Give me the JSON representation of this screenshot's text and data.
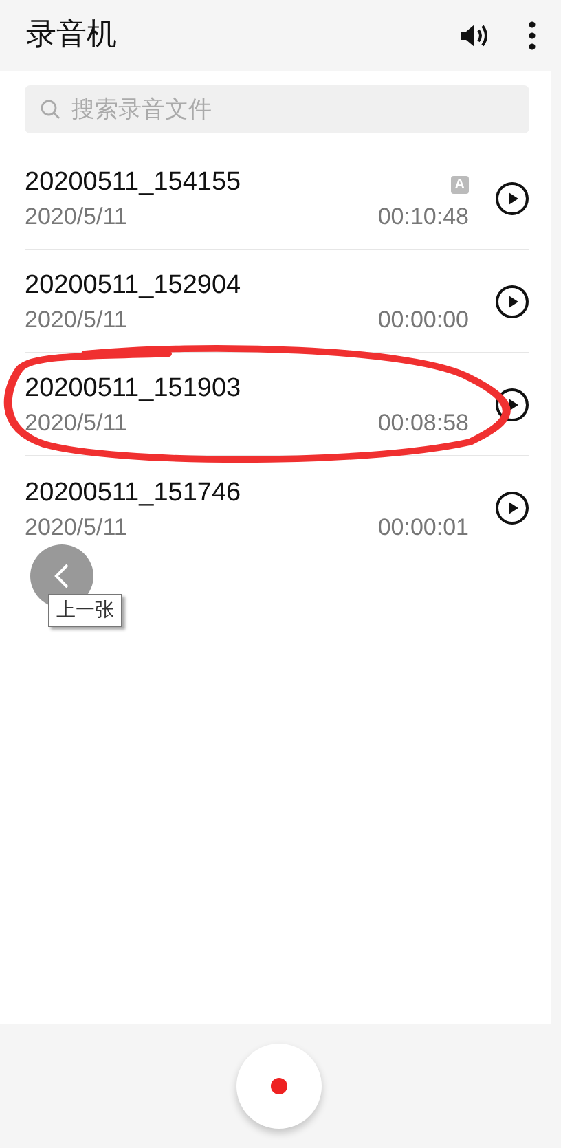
{
  "app_bar": {
    "title": "录音机"
  },
  "search": {
    "placeholder": "搜索录音文件"
  },
  "recordings": [
    {
      "name": "20200511_154155",
      "date": "2020/5/11",
      "duration": "00:10:48",
      "badge": "A",
      "circled": false
    },
    {
      "name": "20200511_152904",
      "date": "2020/5/11",
      "duration": "00:00:00",
      "circled": false
    },
    {
      "name": "20200511_151903",
      "date": "2020/5/11",
      "duration": "00:08:58",
      "circled": true
    },
    {
      "name": "20200511_151746",
      "date": "2020/5/11",
      "duration": "00:00:01",
      "circled": false
    }
  ],
  "viewer_overlay": {
    "tooltip": "上一张"
  },
  "record_button": {
    "kind": "record"
  }
}
